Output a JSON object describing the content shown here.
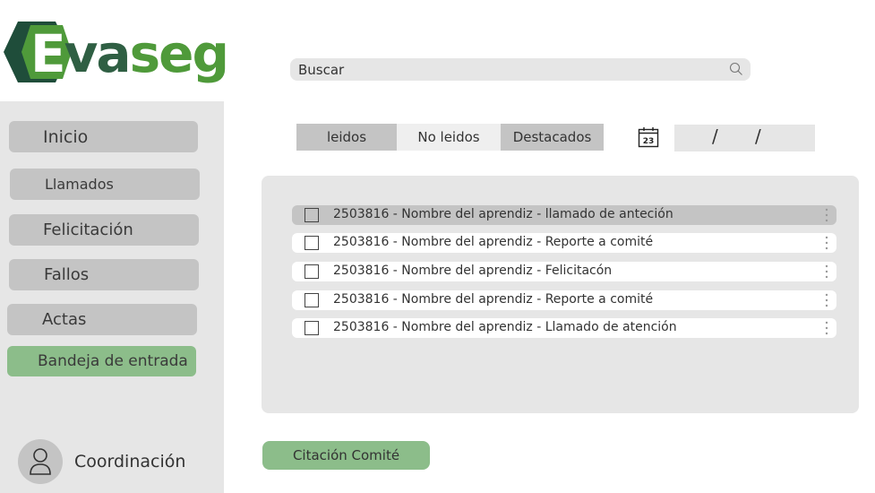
{
  "brand": {
    "logo_letter": "E",
    "logo_rest_a": "va",
    "logo_rest_b": "seg",
    "colors": {
      "dark": "#1f4d3a",
      "mid": "#2f5f43",
      "green": "#4f9a3a"
    }
  },
  "search": {
    "placeholder": "Buscar",
    "icon": "search-icon"
  },
  "sidebar": {
    "items": [
      {
        "label": "Inicio",
        "active": false
      },
      {
        "label": "Llamados",
        "active": false
      },
      {
        "label": "Felicitación",
        "active": false
      },
      {
        "label": "Fallos",
        "active": false
      },
      {
        "label": "Actas",
        "active": false
      },
      {
        "label": "Bandeja de entrada",
        "active": true
      }
    ],
    "profile": {
      "name": "Coordinación",
      "icon": "user-icon"
    }
  },
  "filters": {
    "tabs": [
      {
        "label": "leidos"
      },
      {
        "label": "No leidos"
      },
      {
        "label": "Destacados"
      }
    ],
    "calendar": {
      "icon": "calendar-icon",
      "day": "23"
    },
    "date": {
      "separator_1": "/",
      "separator_2": "/"
    }
  },
  "inbox": {
    "rows": [
      {
        "text": "2503816 - Nombre del aprendiz - llamado de anteción",
        "selected": true
      },
      {
        "text": "2503816 - Nombre del aprendiz - Reporte a comité",
        "selected": false
      },
      {
        "text": "2503816 - Nombre del aprendiz - Felicitacón",
        "selected": false
      },
      {
        "text": "2503816 - Nombre del aprendiz - Reporte a comité",
        "selected": false
      },
      {
        "text": "2503816 - Nombre del aprendiz - Llamado de atención",
        "selected": false
      }
    ]
  },
  "actions": {
    "primary_label": "Citación Comité"
  },
  "colors": {
    "sidebar_bg": "#e6e6e6",
    "item_bg": "#c4c4c4",
    "accent_green": "#8cbd8a"
  }
}
